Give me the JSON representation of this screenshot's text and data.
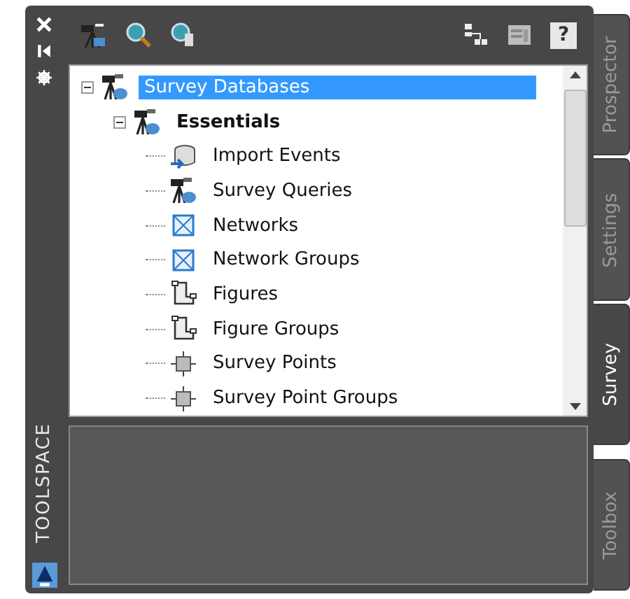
{
  "panel": {
    "title": "TOOLSPACE"
  },
  "toolbar": {
    "help": "?"
  },
  "tree": [
    {
      "label": "Survey Databases",
      "selected": true,
      "expanded": true,
      "bold": false,
      "children": [
        {
          "label": "Essentials",
          "selected": false,
          "expanded": true,
          "bold": true,
          "children": [
            {
              "label": "Import Events",
              "selected": false,
              "bold": false
            },
            {
              "label": "Survey Queries",
              "selected": false,
              "bold": false
            },
            {
              "label": "Networks",
              "selected": false,
              "bold": false
            },
            {
              "label": "Network Groups",
              "selected": false,
              "bold": false
            },
            {
              "label": "Figures",
              "selected": false,
              "bold": false
            },
            {
              "label": "Figure Groups",
              "selected": false,
              "bold": false
            },
            {
              "label": "Survey Points",
              "selected": false,
              "bold": false
            },
            {
              "label": "Survey Point Groups",
              "selected": false,
              "bold": false
            }
          ]
        }
      ]
    }
  ],
  "tabs": [
    {
      "label": "Prospector",
      "selected": false
    },
    {
      "label": "Settings",
      "selected": false
    },
    {
      "label": "Survey",
      "selected": true
    },
    {
      "label": "Toolbox",
      "selected": false
    }
  ]
}
